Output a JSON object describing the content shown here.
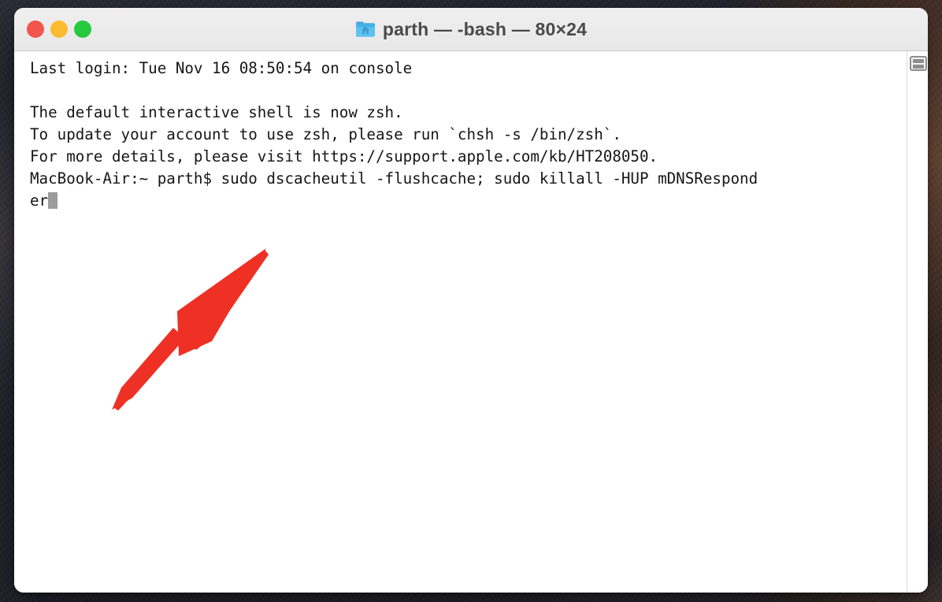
{
  "window": {
    "title": "parth — -bash — 80×24",
    "folder_icon": "home-folder-icon",
    "traffic_lights": [
      {
        "name": "close",
        "color": "#f2554b"
      },
      {
        "name": "minimize",
        "color": "#fdbc2f"
      },
      {
        "name": "zoom",
        "color": "#27c93f"
      }
    ]
  },
  "terminal": {
    "lines": [
      "Last login: Tue Nov 16 08:50:54 on console",
      "",
      "The default interactive shell is now zsh.",
      "To update your account to use zsh, please run `chsh -s /bin/zsh`.",
      "For more details, please visit https://support.apple.com/kb/HT208050.",
      "MacBook-Air:~ parth$ sudo dscacheutil -flushcache; sudo killall -HUP mDNSRespond",
      "er"
    ],
    "prompt": "MacBook-Air:~ parth$",
    "command": "sudo dscacheutil -flushcache; sudo killall -HUP mDNSResponder",
    "cursor": "block-cursor",
    "text_color": "#161616",
    "background_color": "#ffffff"
  },
  "scrollbar": {
    "split_pane_button": "split-pane-icon"
  },
  "annotation": {
    "arrow": "red-arrow-pointing-up-right",
    "color": "#ee3124"
  }
}
